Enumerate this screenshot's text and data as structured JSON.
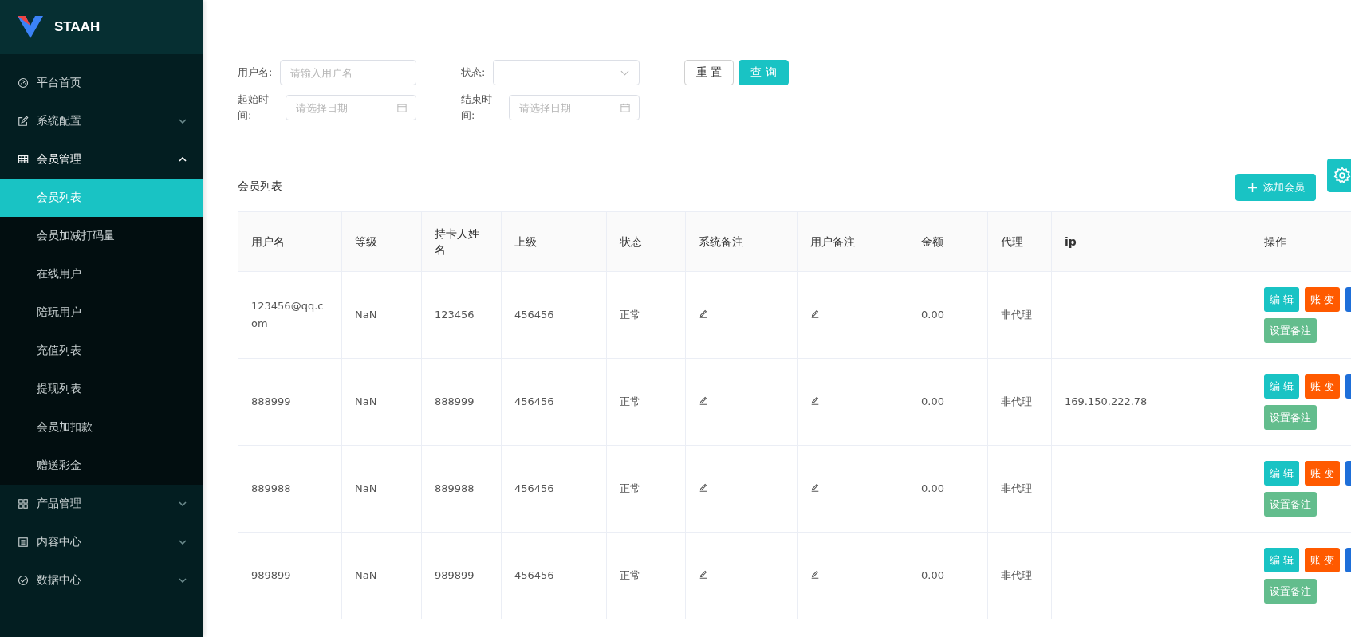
{
  "sidebar": {
    "logo_text": "STAAH",
    "menu": [
      {
        "kind": "link",
        "label": "平台首页"
      },
      {
        "kind": "group",
        "label": "系统配置",
        "expanded": false
      },
      {
        "kind": "group",
        "label": "会员管理",
        "expanded": true,
        "children": [
          {
            "label": "会员列表",
            "selected": true
          },
          {
            "label": "会员加减打码量",
            "selected": false
          },
          {
            "label": "在线用户",
            "selected": false
          },
          {
            "label": "陪玩用户",
            "selected": false
          },
          {
            "label": "充值列表",
            "selected": false
          },
          {
            "label": "提现列表",
            "selected": false
          },
          {
            "label": "会员加扣款",
            "selected": false
          },
          {
            "label": "赠送彩金",
            "selected": false
          }
        ]
      },
      {
        "kind": "group",
        "label": "产品管理",
        "expanded": false
      },
      {
        "kind": "group",
        "label": "内容中心",
        "expanded": false
      },
      {
        "kind": "group",
        "label": "数据中心",
        "expanded": false
      }
    ]
  },
  "filters": {
    "rows": [
      [
        {
          "kind": "text",
          "label": "用户名:",
          "placeholder": "请输入用户名"
        },
        {
          "kind": "select",
          "label": "状态:"
        }
      ],
      [
        {
          "kind": "date",
          "label": "起始时间:",
          "placeholder": "请选择日期"
        },
        {
          "kind": "date",
          "label": "结束时间:",
          "placeholder": "请选择日期"
        }
      ]
    ],
    "buttons": [
      {
        "kind": "plain",
        "label": "重 置"
      },
      {
        "kind": "primary",
        "label": "查 询"
      }
    ]
  },
  "list": {
    "title": "会员列表",
    "add_button": "添加会员",
    "columns": [
      "用户名",
      "等级",
      "持卡人姓名",
      "上级",
      "状态",
      "系统备注",
      "用户备注",
      "金额",
      "代理",
      "ip",
      "操作"
    ],
    "rows": [
      {
        "cells": [
          "123456@qq.com",
          "NaN",
          "123456",
          "456456",
          "正常",
          null,
          null,
          "0.00",
          "非代理",
          ""
        ],
        "actions": [
          {
            "kind": "edit",
            "label": "编 辑"
          },
          {
            "kind": "ledger",
            "label": "账 变"
          },
          {
            "kind": "note",
            "label": "设置备注"
          }
        ]
      },
      {
        "cells": [
          "888999",
          "NaN",
          "888999",
          "456456",
          "正常",
          null,
          null,
          "0.00",
          "非代理",
          "169.150.222.78"
        ],
        "actions": [
          {
            "kind": "edit",
            "label": "编 辑"
          },
          {
            "kind": "ledger",
            "label": "账 变"
          },
          {
            "kind": "note",
            "label": "设置备注"
          }
        ]
      },
      {
        "cells": [
          "889988",
          "NaN",
          "889988",
          "456456",
          "正常",
          null,
          null,
          "0.00",
          "非代理",
          ""
        ],
        "actions": [
          {
            "kind": "edit",
            "label": "编 辑"
          },
          {
            "kind": "ledger",
            "label": "账 变"
          },
          {
            "kind": "note",
            "label": "设置备注"
          }
        ]
      },
      {
        "cells": [
          "989899",
          "NaN",
          "989899",
          "456456",
          "正常",
          null,
          null,
          "0.00",
          "非代理",
          ""
        ],
        "actions": [
          {
            "kind": "edit",
            "label": "编 辑"
          },
          {
            "kind": "ledger",
            "label": "账 变"
          },
          {
            "kind": "note",
            "label": "设置备注"
          }
        ]
      }
    ]
  }
}
